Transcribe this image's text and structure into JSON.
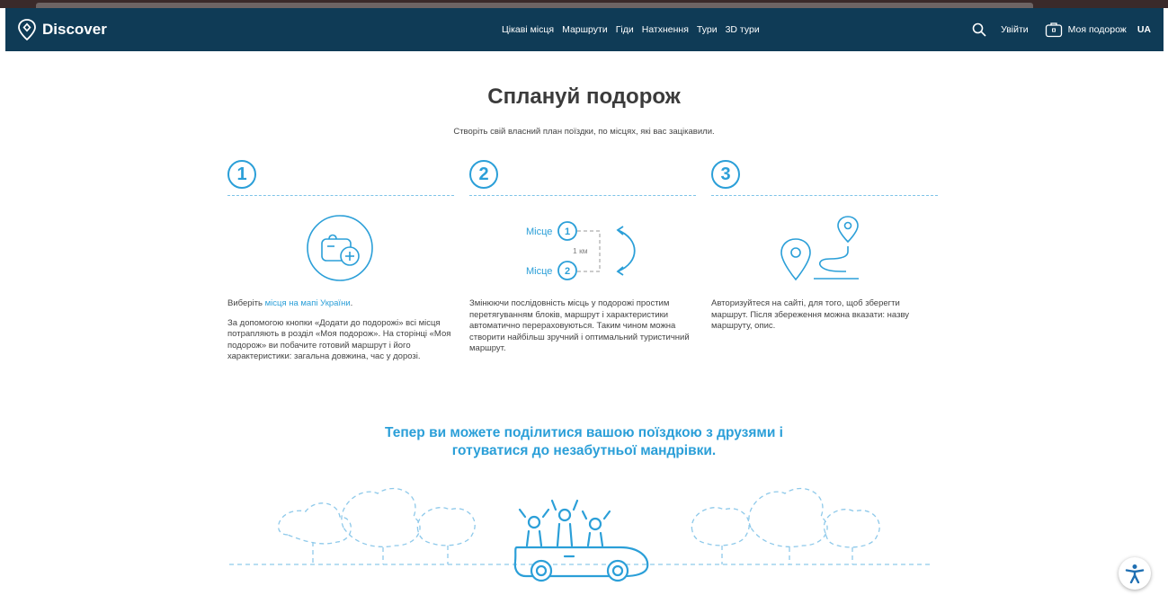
{
  "header": {
    "logo_text": "Discover",
    "nav": [
      "Цікаві місця",
      "Маршрути",
      "Гіди",
      "Натхнення",
      "Тури",
      "3D тури"
    ],
    "login": "Увійти",
    "my_trip": "Моя подорож",
    "lang": "UA"
  },
  "main": {
    "title": "Сплануй подорож",
    "subtitle": "Створіть свій власний план поїздки, по місцях, які вас зацікавили.",
    "steps": [
      {
        "number": "1",
        "lead_prefix": "Виберіть ",
        "lead_link": "місця на мапі України",
        "lead_suffix": ".",
        "text": "За допомогою кнопки «Додати до подорожі» всі місця потрапляють в розділ «Моя подорож». На сторінці «Моя подорож» ви побачите готовий маршрут і його характеристики: загальна довжина, час у дорозі."
      },
      {
        "number": "2",
        "text": "Змінюючи послідовність місць у подорожі простим перетягуванням блоків, маршрут і характеристики автоматично перераховуються. Таким чином можна створити найбільш зручний і оптимальний туристичний маршрут.",
        "diagram": {
          "place_label": "Місце",
          "first": "1",
          "second": "2",
          "distance": "1 км"
        }
      },
      {
        "number": "3",
        "text": "Авторизуйтеся на сайті, для того, щоб зберегти маршрут. Після збереження можна вказати: назву маршруту, опис."
      }
    ],
    "share_line1": "Тепер ви можете поділитися вашою поїздкою з друзями і",
    "share_line2": "готуватися до незабутньої мандрівки."
  },
  "icons": {
    "logo": "map-pin-diamond-icon",
    "search": "search-icon",
    "trip": "suitcase-icon",
    "add_bag": "bag-add-icon",
    "route": "route-pin-icon",
    "accessibility": "accessibility-icon"
  },
  "colors": {
    "navbar": "#0f3b56",
    "accent": "#2b9fd8"
  }
}
